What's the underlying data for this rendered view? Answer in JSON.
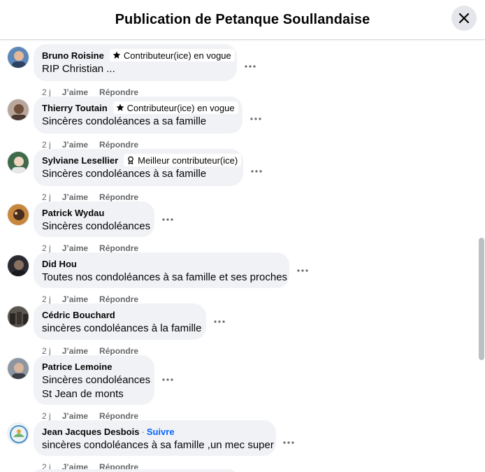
{
  "header": {
    "title": "Publication de Petanque Soullandaise"
  },
  "icons": {
    "close": "close-icon",
    "more": "more-horizontal-icon",
    "star": "star-icon",
    "rosette": "rosette-icon"
  },
  "colors": {
    "bubble": "#f0f2f5",
    "link": "#0866ff",
    "secondary_text": "#65676b"
  },
  "comments": [
    {
      "author": "Bruno Roisine",
      "badge": "Contributeur(ice) en vogue",
      "badge_icon": "star-icon",
      "lines": [
        "RIP Christian ..."
      ],
      "time": "2 j",
      "like": "J’aime",
      "reply": "Répondre"
    },
    {
      "author": "Thierry Toutain",
      "badge": "Contributeur(ice) en vogue",
      "badge_icon": "star-icon",
      "lines": [
        "Sincères condoléances a sa famille"
      ],
      "time": "2 j",
      "like": "J’aime",
      "reply": "Répondre"
    },
    {
      "author": "Sylviane Lesellier",
      "badge": "Meilleur contributeur(ice)",
      "badge_icon": "rosette-icon",
      "lines": [
        "Sincères condoléances à sa famille"
      ],
      "time": "2 j",
      "like": "J’aime",
      "reply": "Répondre"
    },
    {
      "author": "Patrick Wydau",
      "lines": [
        "Sincères condoléances"
      ],
      "time": "2 j",
      "like": "J’aime",
      "reply": "Répondre"
    },
    {
      "author": "Did Hou",
      "lines": [
        "Toutes nos condoléances à sa famille et ses proches"
      ],
      "time": "2 j",
      "like": "J’aime",
      "reply": "Répondre"
    },
    {
      "author": "Cédric Bouchard",
      "lines": [
        "sincères condoléances à la famille"
      ],
      "time": "2 j",
      "like": "J’aime",
      "reply": "Répondre"
    },
    {
      "author": "Patrice Lemoine",
      "lines": [
        "Sincères condoléances",
        "St Jean de monts"
      ],
      "time": "2 j",
      "like": "J’aime",
      "reply": "Répondre"
    },
    {
      "author": "Jean Jacques Desbois",
      "separator": "·",
      "follow": "Suivre",
      "lines": [
        "sincères condoléances à sa famille ,un mec super"
      ],
      "time": "2 j",
      "like": "J’aime",
      "reply": "Répondre"
    }
  ]
}
